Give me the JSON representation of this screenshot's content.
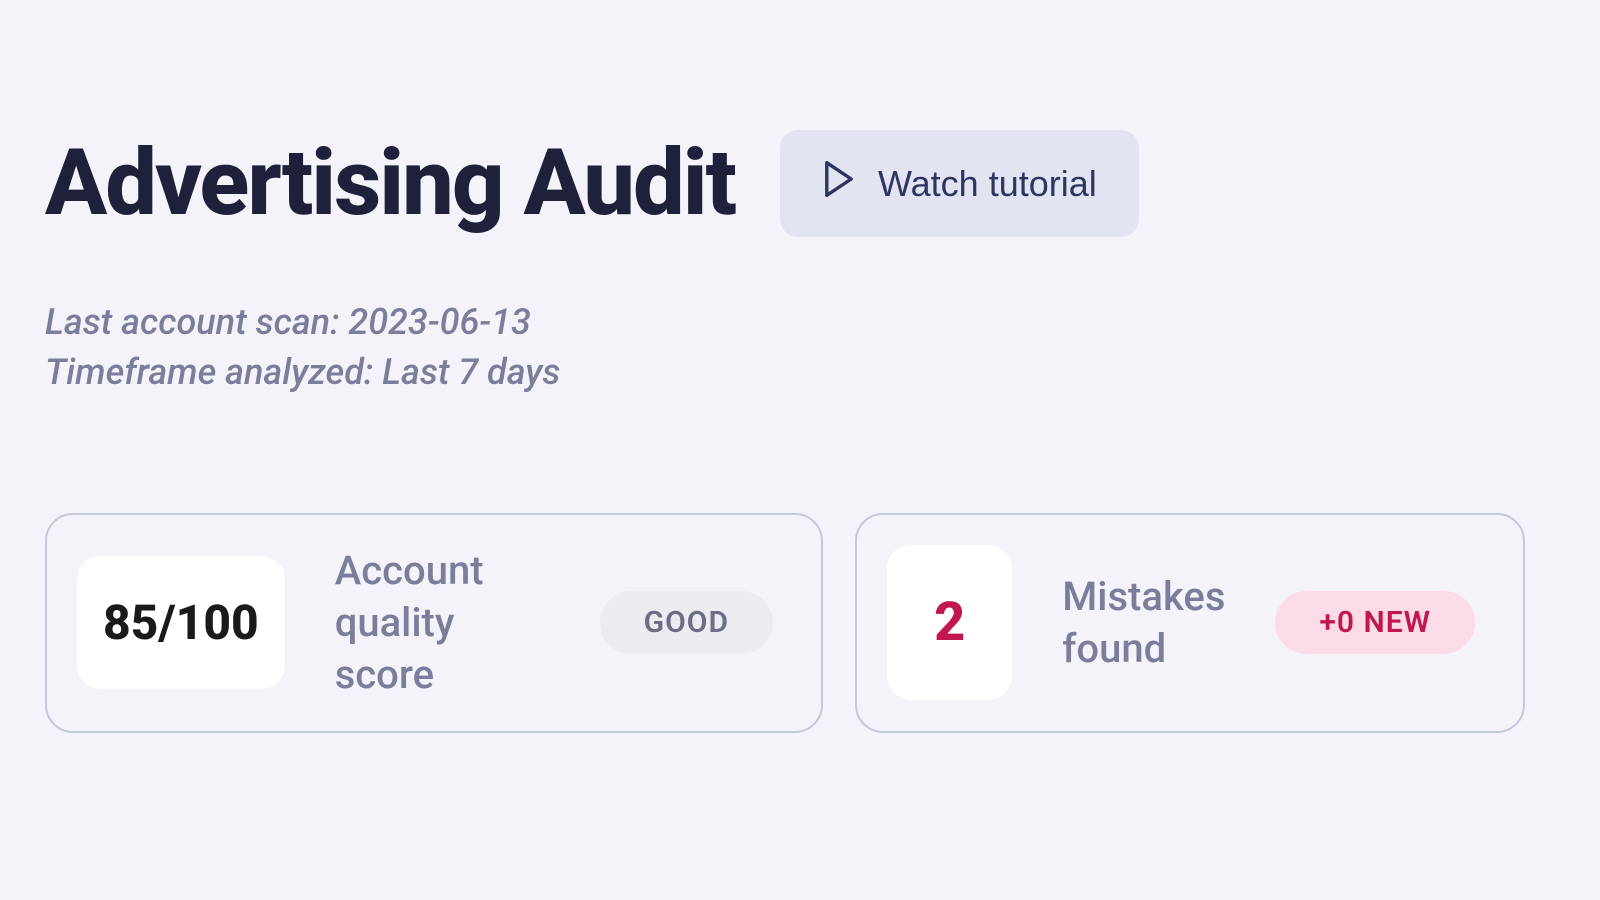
{
  "header": {
    "title": "Advertising Audit",
    "tutorial_label": "Watch tutorial"
  },
  "meta": {
    "last_scan_line": "Last account scan: 2023-06-13",
    "timeframe_line": "Timeframe analyzed: Last 7 days"
  },
  "cards": {
    "score": {
      "value": "85/100",
      "label": "Account quality score",
      "badge": "GOOD"
    },
    "mistakes": {
      "value": "2",
      "label": "Mistakes found",
      "badge": "+0 NEW"
    }
  }
}
